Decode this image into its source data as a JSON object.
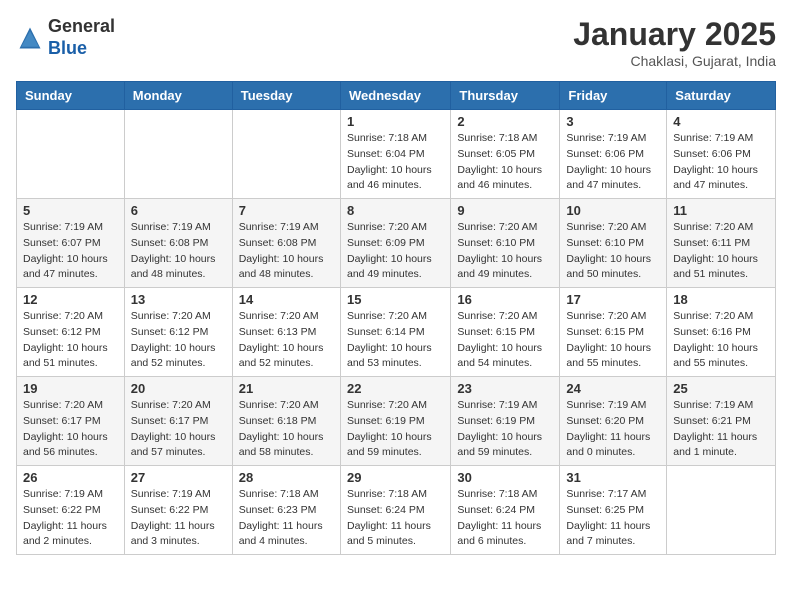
{
  "header": {
    "logo_general": "General",
    "logo_blue": "Blue",
    "month_year": "January 2025",
    "location": "Chaklasi, Gujarat, India"
  },
  "days_of_week": [
    "Sunday",
    "Monday",
    "Tuesday",
    "Wednesday",
    "Thursday",
    "Friday",
    "Saturday"
  ],
  "weeks": [
    [
      {
        "day": "",
        "info": ""
      },
      {
        "day": "",
        "info": ""
      },
      {
        "day": "",
        "info": ""
      },
      {
        "day": "1",
        "info": "Sunrise: 7:18 AM\nSunset: 6:04 PM\nDaylight: 10 hours\nand 46 minutes."
      },
      {
        "day": "2",
        "info": "Sunrise: 7:18 AM\nSunset: 6:05 PM\nDaylight: 10 hours\nand 46 minutes."
      },
      {
        "day": "3",
        "info": "Sunrise: 7:19 AM\nSunset: 6:06 PM\nDaylight: 10 hours\nand 47 minutes."
      },
      {
        "day": "4",
        "info": "Sunrise: 7:19 AM\nSunset: 6:06 PM\nDaylight: 10 hours\nand 47 minutes."
      }
    ],
    [
      {
        "day": "5",
        "info": "Sunrise: 7:19 AM\nSunset: 6:07 PM\nDaylight: 10 hours\nand 47 minutes."
      },
      {
        "day": "6",
        "info": "Sunrise: 7:19 AM\nSunset: 6:08 PM\nDaylight: 10 hours\nand 48 minutes."
      },
      {
        "day": "7",
        "info": "Sunrise: 7:19 AM\nSunset: 6:08 PM\nDaylight: 10 hours\nand 48 minutes."
      },
      {
        "day": "8",
        "info": "Sunrise: 7:20 AM\nSunset: 6:09 PM\nDaylight: 10 hours\nand 49 minutes."
      },
      {
        "day": "9",
        "info": "Sunrise: 7:20 AM\nSunset: 6:10 PM\nDaylight: 10 hours\nand 49 minutes."
      },
      {
        "day": "10",
        "info": "Sunrise: 7:20 AM\nSunset: 6:10 PM\nDaylight: 10 hours\nand 50 minutes."
      },
      {
        "day": "11",
        "info": "Sunrise: 7:20 AM\nSunset: 6:11 PM\nDaylight: 10 hours\nand 51 minutes."
      }
    ],
    [
      {
        "day": "12",
        "info": "Sunrise: 7:20 AM\nSunset: 6:12 PM\nDaylight: 10 hours\nand 51 minutes."
      },
      {
        "day": "13",
        "info": "Sunrise: 7:20 AM\nSunset: 6:12 PM\nDaylight: 10 hours\nand 52 minutes."
      },
      {
        "day": "14",
        "info": "Sunrise: 7:20 AM\nSunset: 6:13 PM\nDaylight: 10 hours\nand 52 minutes."
      },
      {
        "day": "15",
        "info": "Sunrise: 7:20 AM\nSunset: 6:14 PM\nDaylight: 10 hours\nand 53 minutes."
      },
      {
        "day": "16",
        "info": "Sunrise: 7:20 AM\nSunset: 6:15 PM\nDaylight: 10 hours\nand 54 minutes."
      },
      {
        "day": "17",
        "info": "Sunrise: 7:20 AM\nSunset: 6:15 PM\nDaylight: 10 hours\nand 55 minutes."
      },
      {
        "day": "18",
        "info": "Sunrise: 7:20 AM\nSunset: 6:16 PM\nDaylight: 10 hours\nand 55 minutes."
      }
    ],
    [
      {
        "day": "19",
        "info": "Sunrise: 7:20 AM\nSunset: 6:17 PM\nDaylight: 10 hours\nand 56 minutes."
      },
      {
        "day": "20",
        "info": "Sunrise: 7:20 AM\nSunset: 6:17 PM\nDaylight: 10 hours\nand 57 minutes."
      },
      {
        "day": "21",
        "info": "Sunrise: 7:20 AM\nSunset: 6:18 PM\nDaylight: 10 hours\nand 58 minutes."
      },
      {
        "day": "22",
        "info": "Sunrise: 7:20 AM\nSunset: 6:19 PM\nDaylight: 10 hours\nand 59 minutes."
      },
      {
        "day": "23",
        "info": "Sunrise: 7:19 AM\nSunset: 6:19 PM\nDaylight: 10 hours\nand 59 minutes."
      },
      {
        "day": "24",
        "info": "Sunrise: 7:19 AM\nSunset: 6:20 PM\nDaylight: 11 hours\nand 0 minutes."
      },
      {
        "day": "25",
        "info": "Sunrise: 7:19 AM\nSunset: 6:21 PM\nDaylight: 11 hours\nand 1 minute."
      }
    ],
    [
      {
        "day": "26",
        "info": "Sunrise: 7:19 AM\nSunset: 6:22 PM\nDaylight: 11 hours\nand 2 minutes."
      },
      {
        "day": "27",
        "info": "Sunrise: 7:19 AM\nSunset: 6:22 PM\nDaylight: 11 hours\nand 3 minutes."
      },
      {
        "day": "28",
        "info": "Sunrise: 7:18 AM\nSunset: 6:23 PM\nDaylight: 11 hours\nand 4 minutes."
      },
      {
        "day": "29",
        "info": "Sunrise: 7:18 AM\nSunset: 6:24 PM\nDaylight: 11 hours\nand 5 minutes."
      },
      {
        "day": "30",
        "info": "Sunrise: 7:18 AM\nSunset: 6:24 PM\nDaylight: 11 hours\nand 6 minutes."
      },
      {
        "day": "31",
        "info": "Sunrise: 7:17 AM\nSunset: 6:25 PM\nDaylight: 11 hours\nand 7 minutes."
      },
      {
        "day": "",
        "info": ""
      }
    ]
  ]
}
